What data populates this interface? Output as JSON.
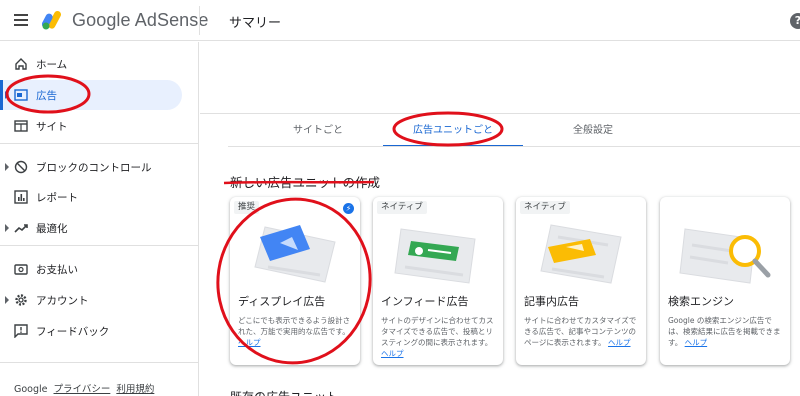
{
  "header": {
    "brand": "Google AdSense",
    "page_title": "サマリー",
    "help_icon": "?"
  },
  "sidebar": {
    "items": [
      {
        "label": "ホーム",
        "icon": "home-icon"
      },
      {
        "label": "広告",
        "icon": "ad-unit-icon",
        "active": true
      },
      {
        "label": "サイト",
        "icon": "site-icon"
      },
      {
        "label": "ブロックのコントロール",
        "icon": "block-icon"
      },
      {
        "label": "レポート",
        "icon": "report-icon"
      },
      {
        "label": "最適化",
        "icon": "trend-icon"
      },
      {
        "label": "お支払い",
        "icon": "payment-icon"
      },
      {
        "label": "アカウント",
        "icon": "gear-icon"
      },
      {
        "label": "フィードバック",
        "icon": "feedback-icon"
      }
    ],
    "footer": {
      "google": "Google",
      "privacy": "プライバシー",
      "terms": "利用規約"
    }
  },
  "main": {
    "tabs": [
      {
        "label": "サイトごと"
      },
      {
        "label": "広告ユニットごと",
        "active": true
      },
      {
        "label": "全般設定"
      }
    ],
    "section_title": "新しい広告ユニットの作成",
    "cards": [
      {
        "badge": "推奨",
        "title": "ディスプレイ広告",
        "desc": "どこにでも表示できるよう設計された、万能で実用的な広告です。",
        "help": "ヘルプ"
      },
      {
        "badge": "ネイティブ",
        "title": "インフィード広告",
        "desc": "サイトのデザインに合わせてカスタマイズできる広告で、投稿とリスティングの間に表示されます。",
        "help": "ヘルプ"
      },
      {
        "badge": "ネイティブ",
        "title": "記事内広告",
        "desc": "サイトに合わせてカスタマイズできる広告で、記事やコンテンツのページに表示されます。",
        "help": "ヘルプ"
      },
      {
        "badge": "",
        "title": "検索エンジン",
        "desc": "Google の検索エンジン広告では、検索結果に広告を掲載できます。",
        "help": "ヘルプ"
      }
    ],
    "bottom_title": "既存の広告ユニット"
  },
  "colors": {
    "accent": "#1967d2",
    "annotation": "#e0101b",
    "active_bg": "#e8f0fe"
  }
}
